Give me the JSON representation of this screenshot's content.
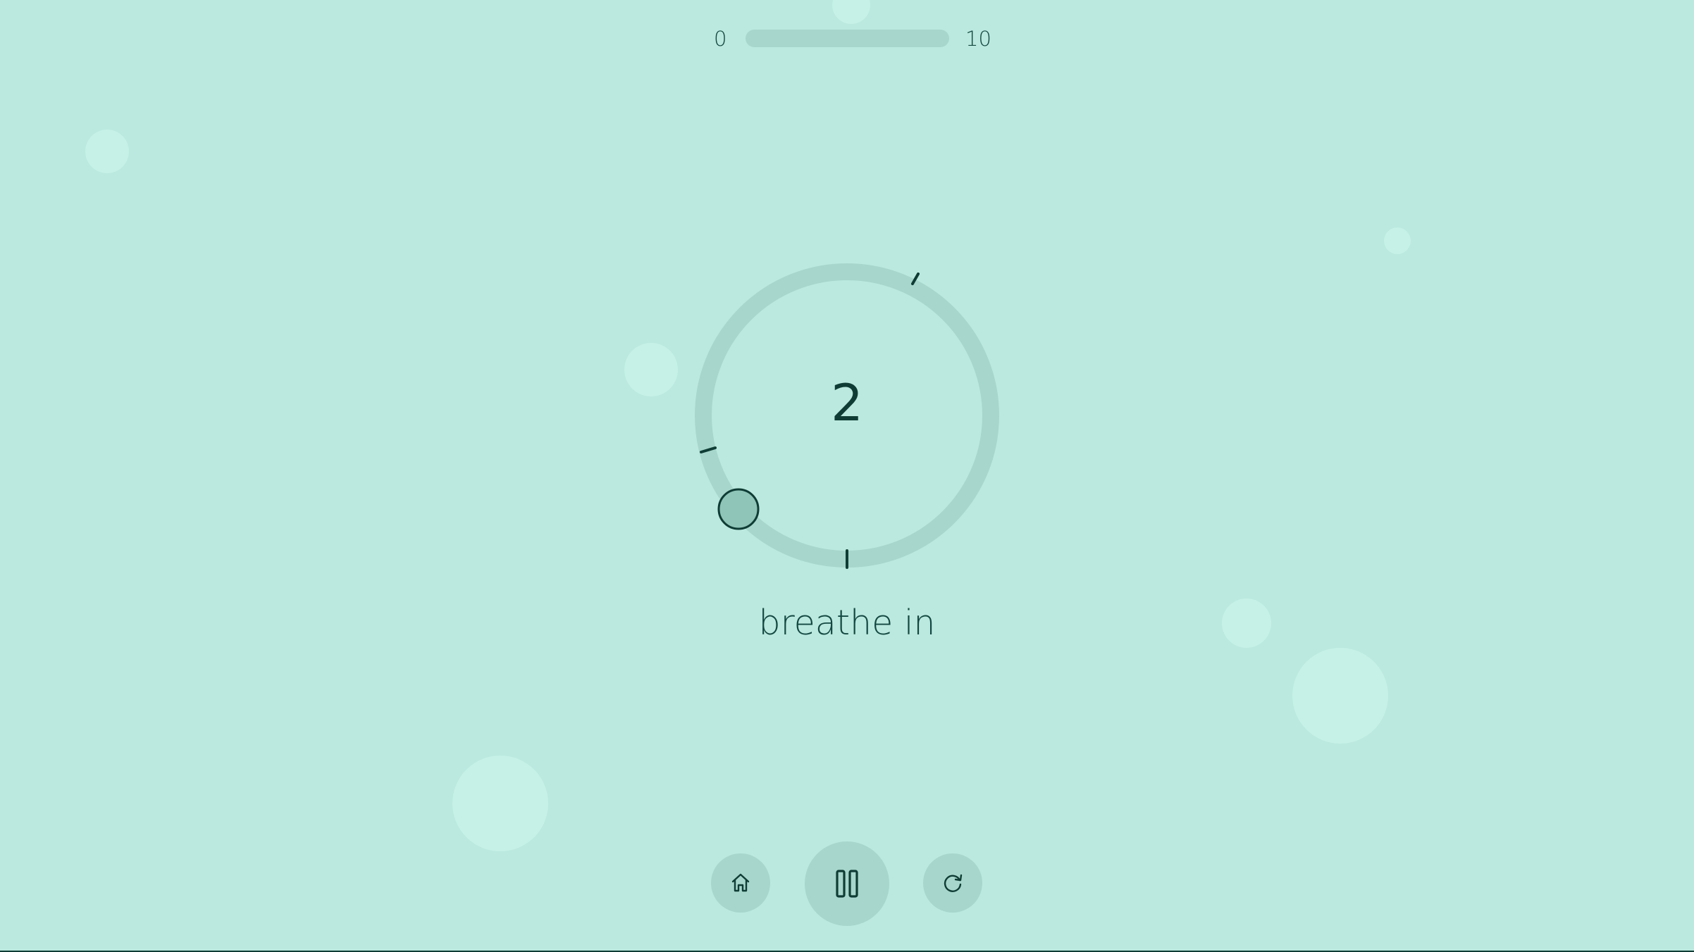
{
  "progress": {
    "min_label": "0",
    "max_label": "10",
    "value": 0
  },
  "breath": {
    "count": "2",
    "phase": "breathe in"
  },
  "controls": {
    "home_icon": "home-icon",
    "pause_icon": "pause-icon",
    "restart_icon": "restart-icon"
  },
  "colors": {
    "background": "#bbe9df",
    "bubble": "#c6f1e7",
    "track": "#a7d6cc",
    "ink": "#0f3d35",
    "marker": "#8fc4b8"
  }
}
